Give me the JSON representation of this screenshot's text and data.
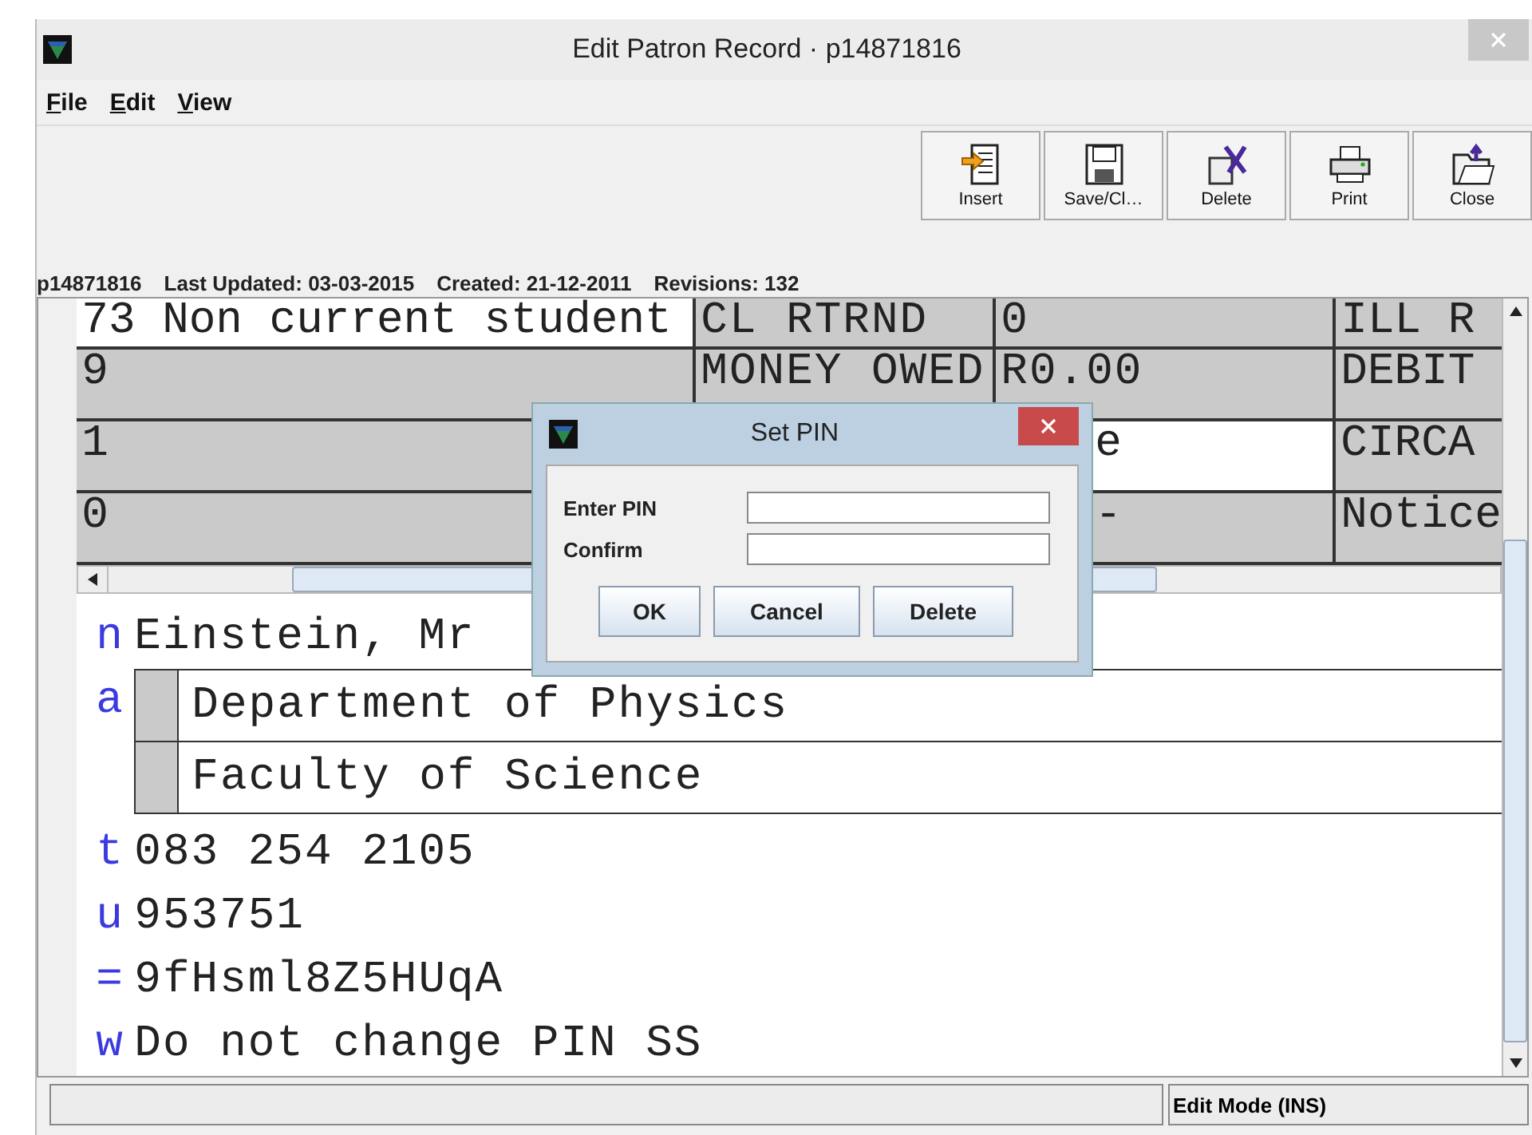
{
  "window": {
    "title": "Edit Patron Record · p14871816"
  },
  "menu": [
    "File",
    "Edit",
    "View"
  ],
  "toolbar": [
    {
      "label": "Insert",
      "kind": "insert"
    },
    {
      "label": "Save/Cl…",
      "kind": "save"
    },
    {
      "label": "Delete",
      "kind": "delete"
    },
    {
      "label": "Print",
      "kind": "print"
    },
    {
      "label": "Close",
      "kind": "close"
    }
  ],
  "info": [
    "p14871816",
    "Last Updated: 03-03-2015",
    "Created: 21-12-2011",
    "Revisions: 132"
  ],
  "fixed_fields": [
    {
      "column_1": {
        "text": "73 Non current student",
        "highlighted": true
      },
      "column_2": {
        "text": "CL RTRND",
        "highlighted": false
      },
      "column_3": {
        "text": "0",
        "highlighted": false
      },
      "column_4": {
        "text": "ILL R",
        "highlighted": false
      }
    },
    {
      "column_1": {
        "text": "9",
        "highlighted": false
      },
      "column_2": {
        "text": "MONEY OWED",
        "highlighted": false
      },
      "column_3": {
        "text": "R0.00",
        "highlighted": false
      },
      "column_4": {
        "text": "DEBIT",
        "highlighted": false
      }
    },
    {
      "column_1": {
        "text": "1",
        "highlighted": false
      },
      "column_3": {
        "text": "e",
        "highlighted": true,
        "covered": true
      },
      "column_4": {
        "text": "CIRCA",
        "highlighted": false
      }
    },
    {
      "column_1": {
        "text": "0",
        "highlighted": false
      },
      "column_3": {
        "text": "-",
        "highlighted": false,
        "covered": true
      },
      "column_4": {
        "text": "Notice",
        "highlighted": false
      }
    }
  ],
  "variable_fields": [
    {
      "kind": "line",
      "tag": "n",
      "value": "Einstein, Mr"
    },
    {
      "kind": "box",
      "tag": "a",
      "lines": [
        "Department of Physics",
        "Faculty of Science"
      ]
    },
    {
      "kind": "line",
      "tag": "t",
      "value": "083 254 2105"
    },
    {
      "kind": "line",
      "tag": "u",
      "value": "953751"
    },
    {
      "kind": "line",
      "tag": "=",
      "value": "9fHsml8Z5HUqA"
    },
    {
      "kind": "line",
      "tag": "w",
      "value": "Do not change PIN SS"
    }
  ],
  "dialog": {
    "title": "Set PIN",
    "fields": [
      {
        "label": "Enter PIN"
      },
      {
        "label": "Confirm"
      }
    ],
    "buttons": [
      "OK",
      "Cancel",
      "Delete"
    ]
  },
  "status_bar": {
    "mode": "Edit Mode (INS)"
  }
}
